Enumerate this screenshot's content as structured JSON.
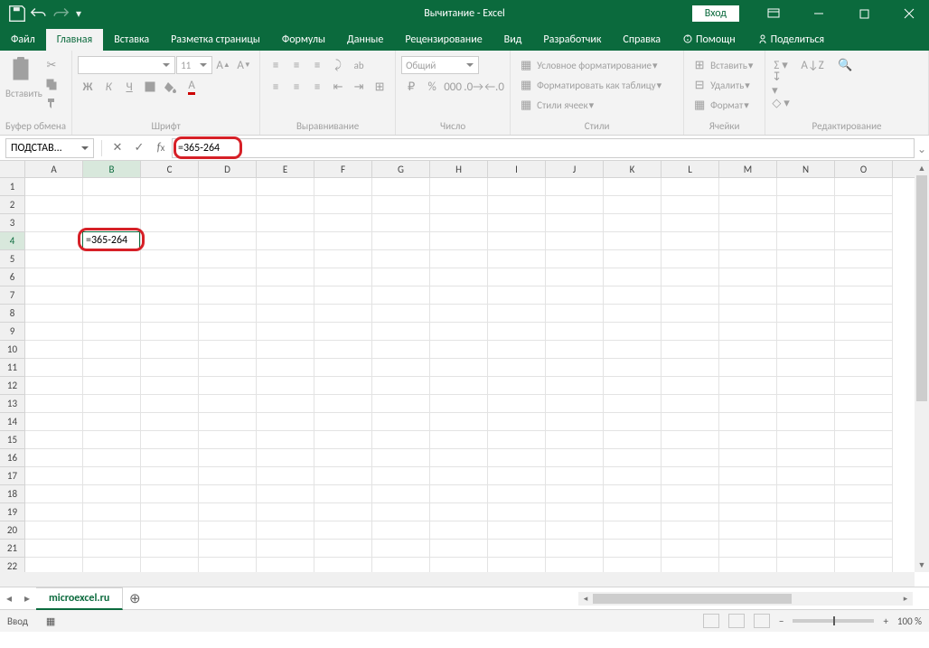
{
  "title": "Вычитание - Excel",
  "account": "Вход",
  "tabs": {
    "file": "Файл",
    "home": "Главная",
    "insert": "Вставка",
    "layout": "Разметка страницы",
    "formulas": "Формулы",
    "data": "Данные",
    "review": "Рецензирование",
    "view": "Вид",
    "developer": "Разработчик",
    "help": "Справка",
    "tellme": "Помощн",
    "share": "Поделиться"
  },
  "ribbon": {
    "clipboard": {
      "label": "Буфер обмена",
      "paste": "Вставить"
    },
    "font": {
      "label": "Шрифт",
      "size": "11",
      "bold": "Ж",
      "italic": "К",
      "underline": "Ч"
    },
    "alignment": {
      "label": "Выравнивание"
    },
    "number": {
      "label": "Число",
      "format": "Общий"
    },
    "styles": {
      "label": "Стили",
      "cond": "Условное форматирование",
      "table": "Форматировать как таблицу",
      "cell": "Стили ячеек"
    },
    "cells": {
      "label": "Ячейки",
      "insert": "Вставить",
      "delete": "Удалить",
      "format": "Формат"
    },
    "editing": {
      "label": "Редактирование"
    }
  },
  "namebox": "ПОДСТАВ...",
  "formula": "=365-264",
  "cellFormula": "=365-264",
  "activeCell": {
    "col": "B",
    "row": 4
  },
  "columns": [
    "A",
    "B",
    "C",
    "D",
    "E",
    "F",
    "G",
    "H",
    "I",
    "J",
    "K",
    "L",
    "M",
    "N",
    "O"
  ],
  "rows": [
    1,
    2,
    3,
    4,
    5,
    6,
    7,
    8,
    9,
    10,
    11,
    12,
    13,
    14,
    15,
    16,
    17,
    18,
    19,
    20,
    21,
    22
  ],
  "sheet": "microexcel.ru",
  "status": "Ввод",
  "zoom": "100 %"
}
